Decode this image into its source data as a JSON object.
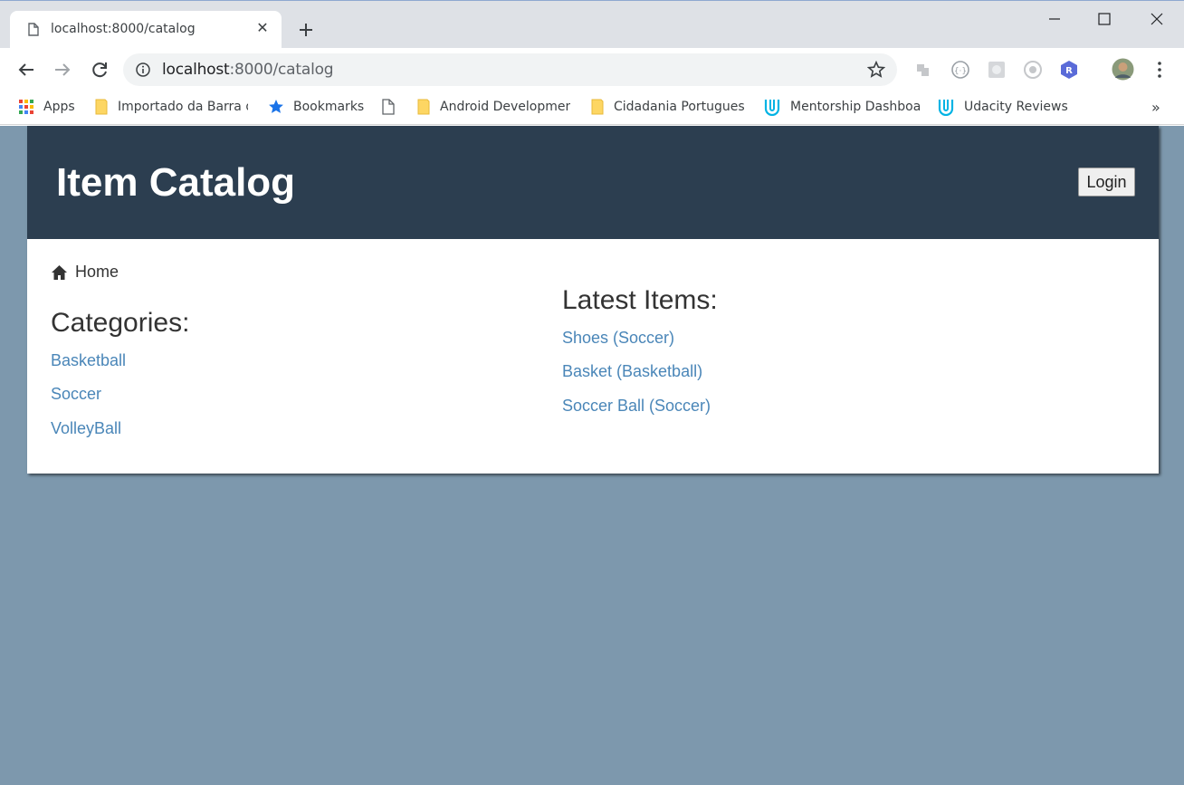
{
  "browser": {
    "tab_title": "localhost:8000/catalog",
    "url_host": "localhost",
    "url_path": ":8000/catalog",
    "bookmarks": [
      {
        "label": "Apps",
        "icon": "apps-grid-icon"
      },
      {
        "label": "Importado da Barra d",
        "icon": "folder-icon"
      },
      {
        "label": "Bookmarks",
        "icon": "star-icon"
      },
      {
        "label": "",
        "icon": "page-icon"
      },
      {
        "label": "Android Developmen",
        "icon": "folder-icon"
      },
      {
        "label": "Cidadania Portugues",
        "icon": "folder-icon"
      },
      {
        "label": "Mentorship Dashboa",
        "icon": "udacity-icon"
      },
      {
        "label": "Udacity Reviews",
        "icon": "udacity-icon"
      }
    ],
    "more_label": "»"
  },
  "header": {
    "title": "Item Catalog",
    "login_label": "Login"
  },
  "breadcrumb": {
    "home_label": "Home"
  },
  "categories": {
    "title": "Categories:",
    "items": [
      "Basketball",
      "Soccer",
      "VolleyBall"
    ]
  },
  "latest": {
    "title": "Latest Items:",
    "items": [
      "Shoes (Soccer)",
      "Basket (Basketball)",
      "Soccer Ball (Soccer)"
    ]
  },
  "colors": {
    "header_bg": "#2c3e50",
    "page_bg": "#7d98ad",
    "link": "#4a86b8"
  }
}
